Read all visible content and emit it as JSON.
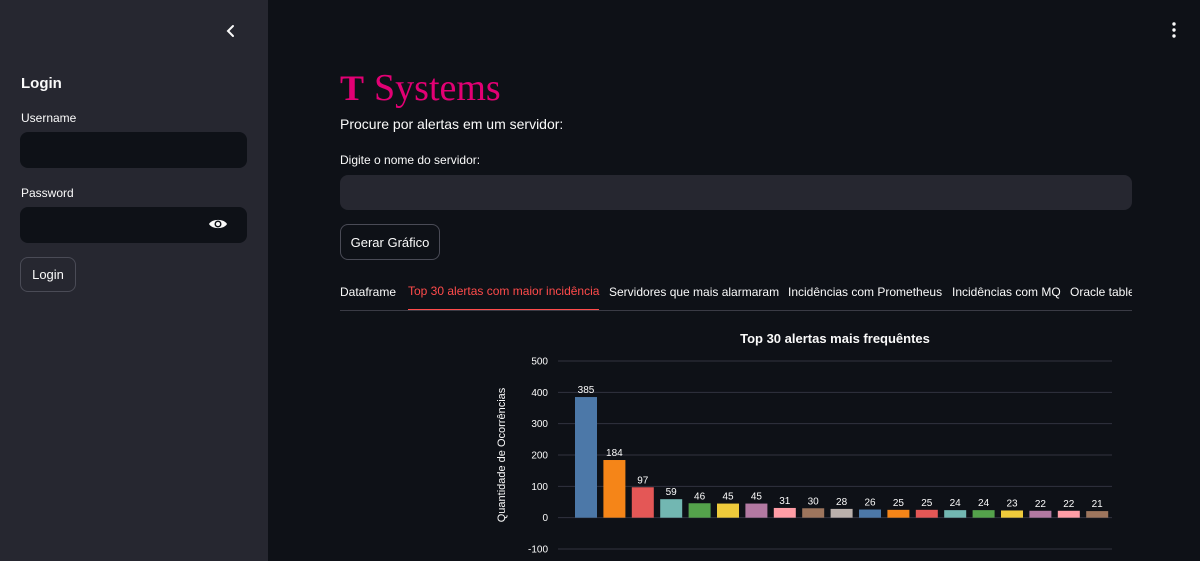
{
  "sidebar": {
    "title": "Login",
    "username_label": "Username",
    "username_value": "",
    "password_label": "Password",
    "password_value": "",
    "login_button": "Login"
  },
  "header": {
    "logo_mark": "T",
    "logo_text": "Systems",
    "subtitle": "Procure por alertas em um servidor:"
  },
  "form": {
    "server_label": "Digite o nome do servidor:",
    "server_value": "",
    "generate_button": "Gerar Gráfico"
  },
  "tabs": [
    {
      "label": "Dataframe",
      "active": false
    },
    {
      "label": "Top 30 alertas com maior incidência",
      "active": true
    },
    {
      "label": "Servidores que mais alarmaram",
      "active": false
    },
    {
      "label": "Incidências com Prometheus",
      "active": false
    },
    {
      "label": "Incidências com MQ",
      "active": false
    },
    {
      "label": "Oracle table",
      "active": false
    }
  ],
  "colors": {
    "brand": "#e20074",
    "accent": "#ff4b4b",
    "sidebar_bg": "#262730",
    "main_bg": "#0e1117"
  },
  "chart_data": {
    "type": "bar",
    "title": "Top 30 alertas mais frequêntes",
    "xlabel": "",
    "ylabel": "Quantidade de Ocorrências",
    "ylim": [
      -100,
      500
    ],
    "yticks": [
      500,
      400,
      300,
      200,
      100,
      0,
      -100
    ],
    "grid": true,
    "values": [
      385,
      184,
      97,
      59,
      46,
      45,
      45,
      31,
      30,
      28,
      26,
      25,
      25,
      24,
      24,
      23,
      22,
      22,
      21
    ],
    "colors": [
      "#4c78a8",
      "#f58518",
      "#e45756",
      "#72b7b2",
      "#54a24b",
      "#eeca3b",
      "#b279a2",
      "#ff9da6",
      "#9d755d",
      "#bab0ac",
      "#4c78a8",
      "#f58518",
      "#e45756",
      "#72b7b2",
      "#54a24b",
      "#eeca3b",
      "#b279a2",
      "#ff9da6",
      "#9d755d"
    ]
  }
}
